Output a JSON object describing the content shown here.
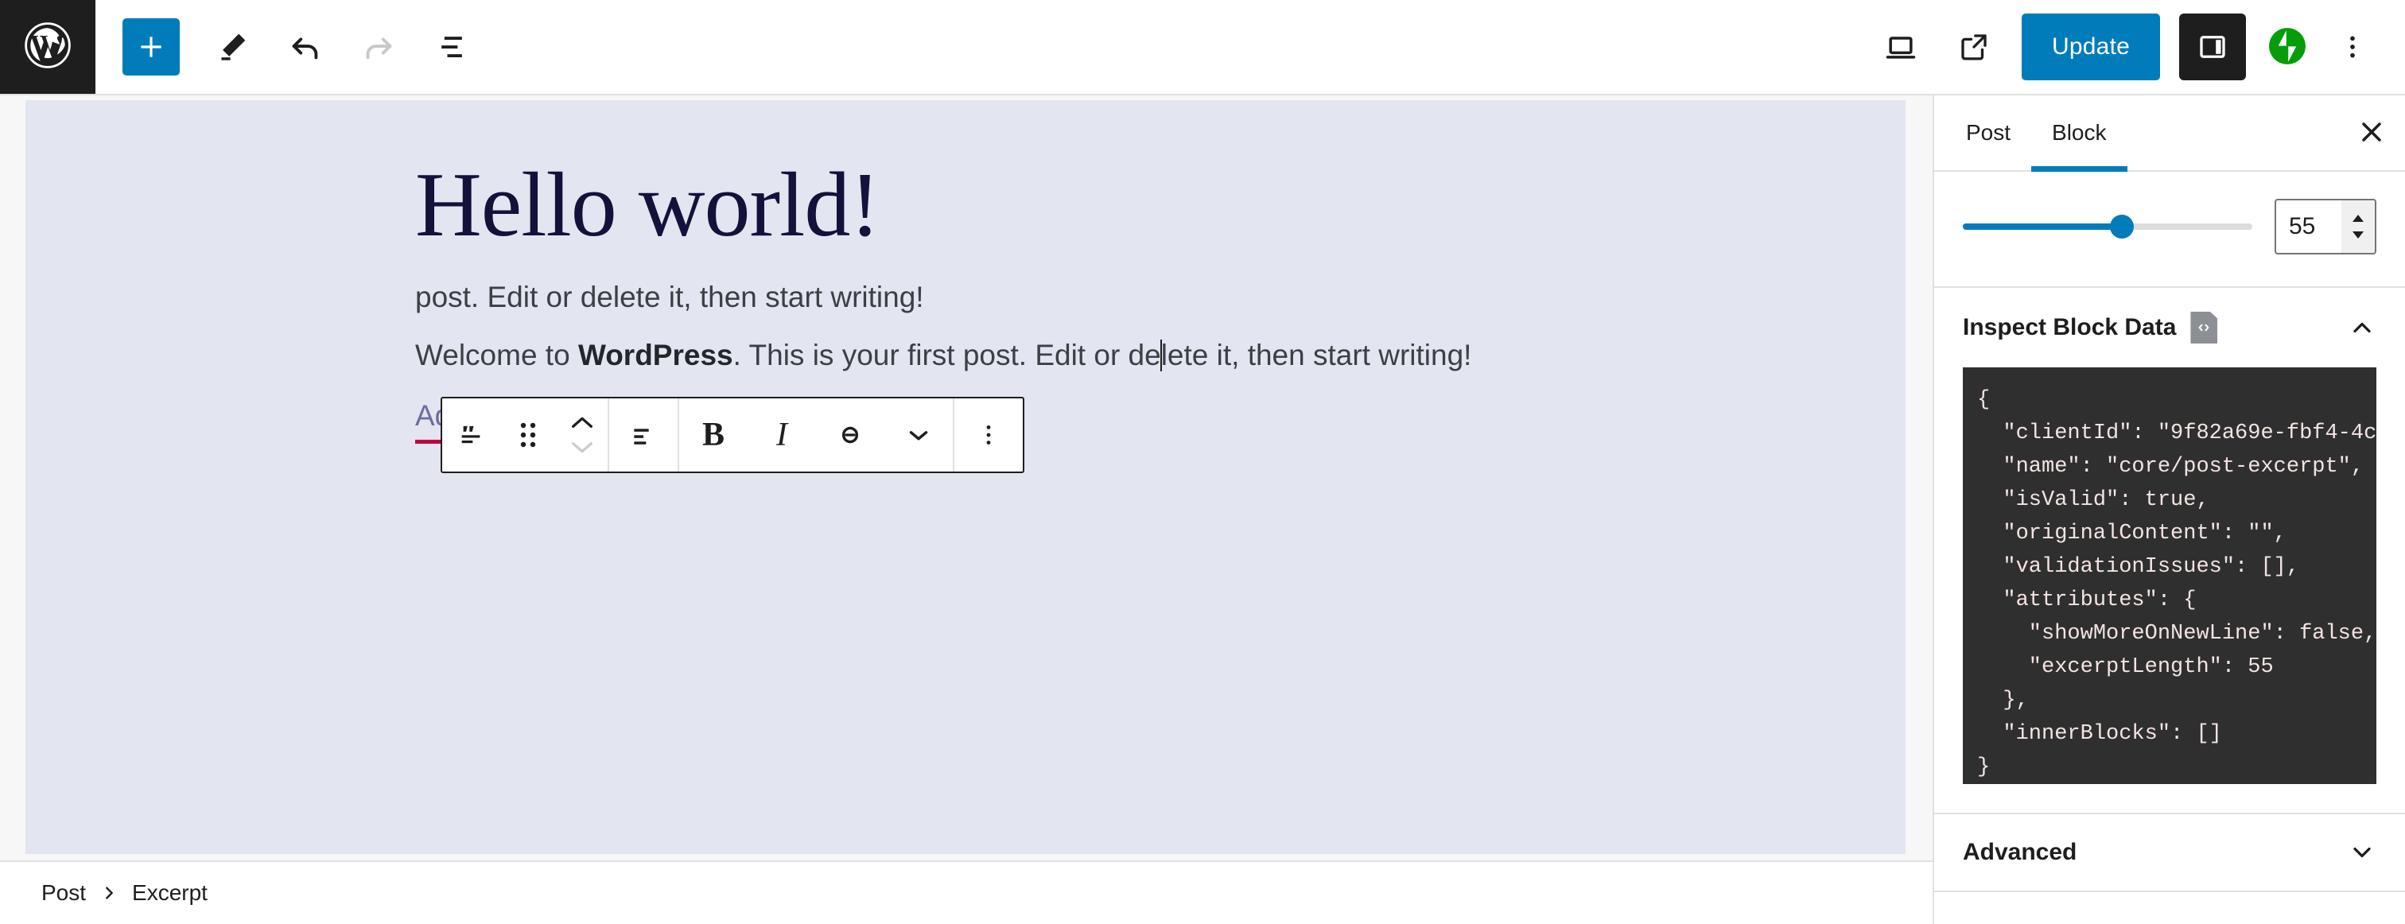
{
  "app": {
    "name": "WordPress Block Editor",
    "accent_color": "#007cba",
    "canvas_color": "#e3e5f1",
    "dark_color": "#1e1e1e",
    "jetpack_color": "#069e08",
    "link_underline_color": "#c3003f"
  },
  "topbar": {
    "logo_label": "WordPress",
    "add_block_label": "Add block",
    "tools_label": "Tools",
    "undo_label": "Undo",
    "redo_label": "Redo",
    "list_view_label": "Document Overview",
    "preview_label": "Preview",
    "view_post_label": "View Post",
    "update_label": "Update",
    "settings_label": "Settings",
    "jetpack_label": "Jetpack",
    "options_label": "Options"
  },
  "canvas": {
    "title": "Hello world!",
    "excerpt_prefix": "Welcome to ",
    "excerpt_bold": "WordPress",
    "excerpt_mid": ". This is your first post. Edit or de",
    "excerpt_tail": "lete it, then start writing!",
    "background_text": "post. Edit or delete it, then start writing!",
    "read_more_placeholder": "Add \"read more\" link text"
  },
  "block_toolbar": {
    "block_type_label": "Excerpt",
    "drag_label": "Drag",
    "move_up_label": "Move up",
    "move_down_label": "Move down",
    "align_label": "Align text",
    "bold_label": "B",
    "italic_label": "I",
    "link_label": "Link",
    "more_rich_text_label": "More",
    "options_label": "Options"
  },
  "breadcrumb": {
    "items": [
      {
        "label": "Post"
      },
      {
        "label": "Excerpt"
      }
    ],
    "separator": "›"
  },
  "sidebar": {
    "tabs": [
      {
        "label": "Post",
        "active": false
      },
      {
        "label": "Block",
        "active": true
      }
    ],
    "close_label": "Close settings",
    "excerpt_length": {
      "value": "55",
      "slider_percent": 55,
      "min": 0,
      "max": 100,
      "increment_label": "Increment",
      "decrement_label": "Decrement"
    },
    "inspect_block_data": {
      "title": "Inspect Block Data",
      "icon": "code-file-icon",
      "expanded": true,
      "code": "{\n  \"clientId\": \"9f82a69e-fbf4-4c\n  \"name\": \"core/post-excerpt\",\n  \"isValid\": true,\n  \"originalContent\": \"\",\n  \"validationIssues\": [],\n  \"attributes\": {\n    \"showMoreOnNewLine\": false,\n    \"excerptLength\": 55\n  },\n  \"innerBlocks\": []\n}"
    },
    "advanced": {
      "title": "Advanced",
      "expanded": false
    }
  }
}
